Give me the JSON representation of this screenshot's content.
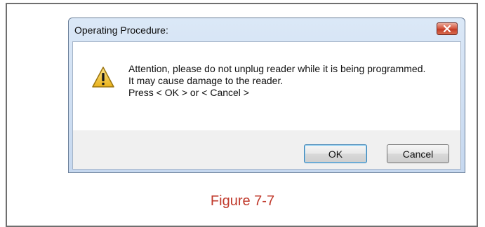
{
  "dialog": {
    "title": "Operating Procedure:",
    "message_lines": [
      "Attention, please do not unplug reader while it is being programmed.",
      "It may cause damage to the reader.",
      "Press < OK > or < Cancel >"
    ],
    "icon": "warning-icon",
    "close_icon": "close-icon",
    "ok_label": "OK",
    "cancel_label": "Cancel"
  },
  "caption": "Figure 7-7",
  "colors": {
    "caption": "#c0392b",
    "close_button": "#c8452f",
    "warning": "#f2c12e"
  }
}
